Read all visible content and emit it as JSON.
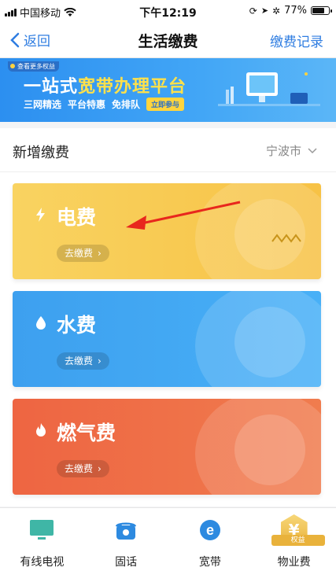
{
  "status_bar": {
    "carrier": "中国移动",
    "time": "下午12:19",
    "battery": "77%",
    "battery_level": 0.77
  },
  "nav": {
    "back_label": "返回",
    "title": "生活缴费",
    "right_label": "缴费记录"
  },
  "banner": {
    "tag": "查看更多权益",
    "title_prefix": "一站式",
    "title_highlight": "宽带办理平台",
    "features": [
      "三网精选",
      "平台特惠",
      "免排队"
    ],
    "cta": "立即参与"
  },
  "section": {
    "title": "新增缴费",
    "city": "宁波市"
  },
  "cards": [
    {
      "title": "电费",
      "action": "去缴费",
      "icon": "lightning-icon",
      "color": "#f8ca50"
    },
    {
      "title": "水费",
      "action": "去缴费",
      "icon": "water-drop-icon",
      "color": "#42a8f3"
    },
    {
      "title": "燃气费",
      "action": "去缴费",
      "icon": "flame-icon",
      "color": "#ef6f48"
    }
  ],
  "tabs": [
    {
      "label": "有线电视",
      "icon": "tv-icon"
    },
    {
      "label": "固话",
      "icon": "telephone-icon"
    },
    {
      "label": "宽带",
      "icon": "broadband-e-icon"
    },
    {
      "label": "物业费",
      "icon": "property-badge-icon",
      "badge": "权益"
    }
  ],
  "colors": {
    "accent": "#2f7de1"
  }
}
